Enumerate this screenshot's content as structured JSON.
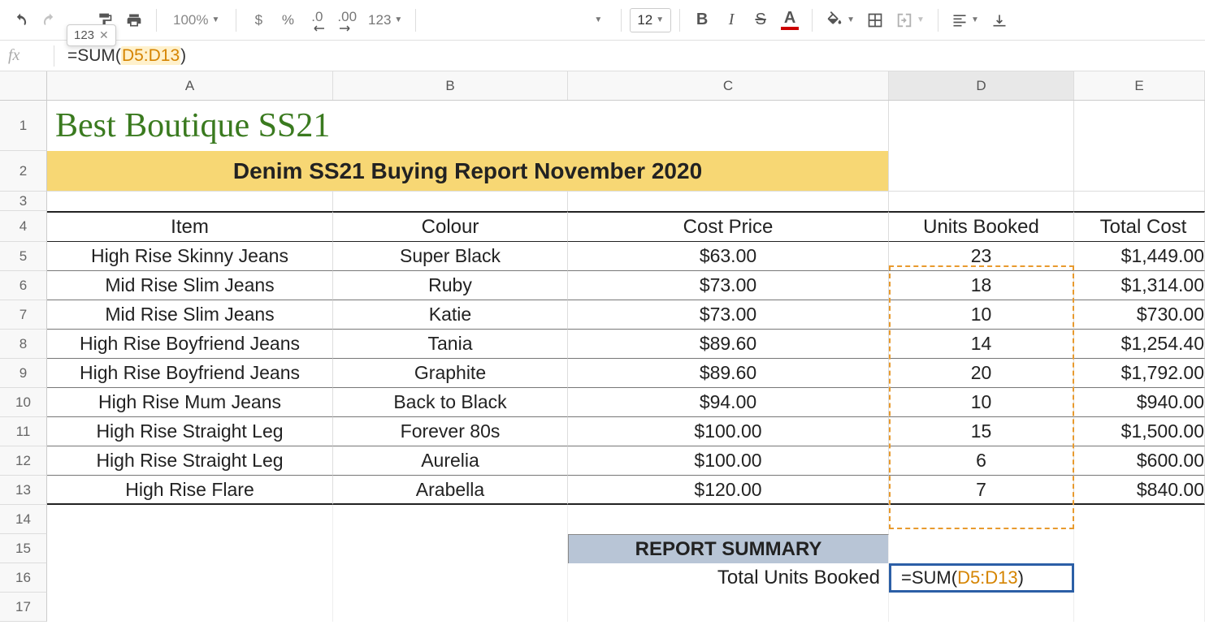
{
  "toolbar": {
    "zoom": "100%",
    "currency": "$",
    "percent": "%",
    "dec_dec": ".0",
    "inc_dec": ".00",
    "more_formats": "123",
    "font_size": "12",
    "tooltip_text": "123"
  },
  "formula_bar": {
    "prefix": "=SUM(",
    "ref": "D5:D13",
    "suffix": ")"
  },
  "columns": [
    "A",
    "B",
    "C",
    "D",
    "E"
  ],
  "rows": [
    "1",
    "2",
    "3",
    "4",
    "5",
    "6",
    "7",
    "8",
    "9",
    "10",
    "11",
    "12",
    "13",
    "14",
    "15",
    "16",
    "17"
  ],
  "title": "Best Boutique SS21",
  "subtitle": "Denim SS21 Buying Report November 2020",
  "headers": {
    "item": "Item",
    "colour": "Colour",
    "price": "Cost Price",
    "units": "Units Booked",
    "total": "Total Cost"
  },
  "data": [
    {
      "item": "High Rise Skinny Jeans",
      "colour": "Super Black",
      "price": "$63.00",
      "units": "23",
      "total": "$1,449.00"
    },
    {
      "item": "Mid Rise Slim Jeans",
      "colour": "Ruby",
      "price": "$73.00",
      "units": "18",
      "total": "$1,314.00"
    },
    {
      "item": "Mid Rise Slim Jeans",
      "colour": "Katie",
      "price": "$73.00",
      "units": "10",
      "total": "$730.00"
    },
    {
      "item": "High Rise Boyfriend Jeans",
      "colour": "Tania",
      "price": "$89.60",
      "units": "14",
      "total": "$1,254.40"
    },
    {
      "item": "High Rise Boyfriend Jeans",
      "colour": "Graphite",
      "price": "$89.60",
      "units": "20",
      "total": "$1,792.00"
    },
    {
      "item": "High Rise Mum Jeans",
      "colour": "Back to Black",
      "price": "$94.00",
      "units": "10",
      "total": "$940.00"
    },
    {
      "item": "High Rise Straight Leg",
      "colour": "Forever 80s",
      "price": "$100.00",
      "units": "15",
      "total": "$1,500.00"
    },
    {
      "item": "High Rise Straight Leg",
      "colour": "Aurelia",
      "price": "$100.00",
      "units": "6",
      "total": "$600.00"
    },
    {
      "item": "High Rise Flare",
      "colour": "Arabella",
      "price": "$120.00",
      "units": "7",
      "total": "$840.00"
    }
  ],
  "summary": {
    "header": "REPORT SUMMARY",
    "label": "Total Units Booked",
    "formula_prefix": "=SUM(",
    "formula_ref": "D5:D13",
    "formula_suffix": ")"
  }
}
